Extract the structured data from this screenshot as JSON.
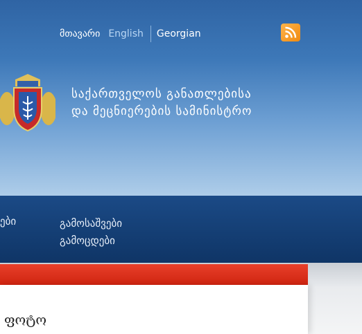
{
  "header": {
    "nav": {
      "home_label": "მთავარი",
      "english_label": "English",
      "georgian_label": "Georgian"
    },
    "rss_icon": "rss-icon",
    "crest_icon": "coat-of-arms-icon",
    "ministry_name_line1": "საქართველოს განათლებისა",
    "ministry_name_line2": "და მეცნიერების სამინისტრო"
  },
  "main_nav": {
    "item_left_label": "ები",
    "item_line1": "გამოსაშვები",
    "item_line2": "გამოცდები"
  },
  "content": {
    "panel_title": "ფოტო"
  },
  "colors": {
    "header_top": "#2f64a4",
    "header_bottom": "#aecde9",
    "nav_bar": "#1b4a86",
    "accent_red": "#e8402a",
    "rss_orange": "#f08a10"
  }
}
